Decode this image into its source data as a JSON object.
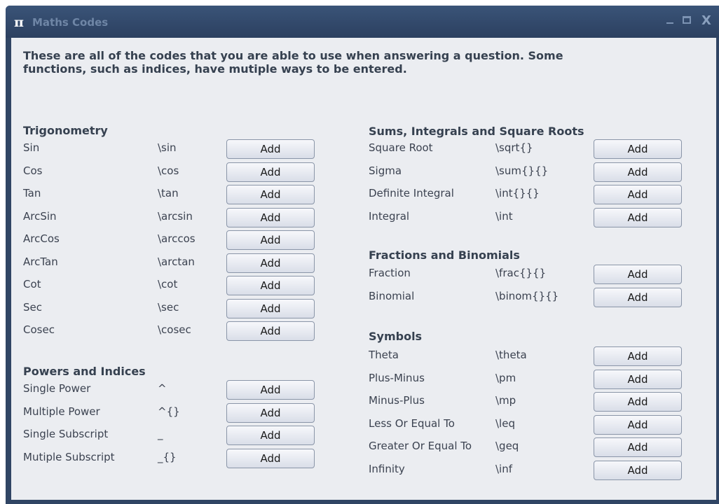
{
  "window": {
    "title": "Maths Codes",
    "icon": "pi-icon"
  },
  "intro": "These are all of the codes that you are able to use when answering a question. Some functions, such as indices, have mutiple ways to be entered.",
  "add_label": "Add",
  "sections": {
    "trigonometry": {
      "heading": "Trigonometry",
      "items": [
        {
          "label": "Sin",
          "code": "\\sin"
        },
        {
          "label": "Cos",
          "code": "\\cos"
        },
        {
          "label": "Tan",
          "code": "\\tan"
        },
        {
          "label": "ArcSin",
          "code": "\\arcsin"
        },
        {
          "label": "ArcCos",
          "code": "\\arccos"
        },
        {
          "label": "ArcTan",
          "code": "\\arctan"
        },
        {
          "label": "Cot",
          "code": "\\cot"
        },
        {
          "label": "Sec",
          "code": "\\sec"
        },
        {
          "label": "Cosec",
          "code": "\\cosec"
        }
      ]
    },
    "powers": {
      "heading": "Powers and Indices",
      "items": [
        {
          "label": "Single Power",
          "code": "^"
        },
        {
          "label": "Multiple Power",
          "code": "^{}"
        },
        {
          "label": "Single Subscript",
          "code": "_"
        },
        {
          "label": "Mutiple Subscript",
          "code": "_{}"
        }
      ]
    },
    "sums": {
      "heading": "Sums, Integrals and Square Roots",
      "items": [
        {
          "label": "Square Root",
          "code": "\\sqrt{}"
        },
        {
          "label": "Sigma",
          "code": "\\sum{}{}"
        },
        {
          "label": "Definite Integral",
          "code": "\\int{}{}"
        },
        {
          "label": "Integral",
          "code": "\\int"
        }
      ]
    },
    "fractions": {
      "heading": "Fractions and Binomials",
      "items": [
        {
          "label": "Fraction",
          "code": "\\frac{}{}"
        },
        {
          "label": "Binomial",
          "code": "\\binom{}{}"
        }
      ]
    },
    "symbols": {
      "heading": "Symbols",
      "items": [
        {
          "label": "Theta",
          "code": "\\theta"
        },
        {
          "label": "Plus-Minus",
          "code": "\\pm"
        },
        {
          "label": "Minus-Plus",
          "code": "\\mp"
        },
        {
          "label": "Less Or Equal To",
          "code": "\\leq"
        },
        {
          "label": "Greater Or Equal To",
          "code": "\\geq"
        },
        {
          "label": "Infinity",
          "code": "\\inf"
        }
      ]
    }
  }
}
